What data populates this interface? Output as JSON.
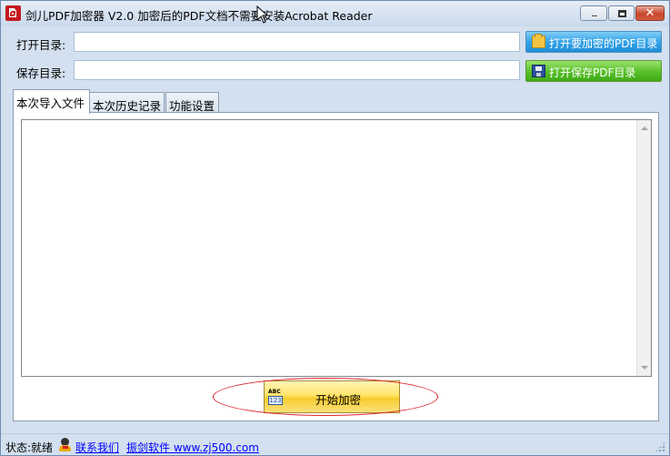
{
  "window": {
    "title": "剑儿PDF加密器  V2.0 加密后的PDF文档不需要安装Acrobat Reader",
    "controls": {
      "minimize": "minimize",
      "maximize": "maximize",
      "close": "✕"
    }
  },
  "open_dir": {
    "label": "打开目录:",
    "value": "",
    "button_label": "打开要加密的PDF目录",
    "icon": "folder-open-icon"
  },
  "save_dir": {
    "label": "保存目录:",
    "value": "",
    "button_label": "打开保存PDF目录",
    "icon": "floppy-disk-icon"
  },
  "tabs": [
    {
      "label": "本次导入文件",
      "active": true
    },
    {
      "label": "本次历史记录",
      "active": false
    },
    {
      "label": "功能设置",
      "active": false
    }
  ],
  "file_list": {
    "items": []
  },
  "start_button": {
    "label": "开始加密",
    "icon": "abc-123-icon",
    "icon_top": "ABC",
    "icon_bottom": "123"
  },
  "status_bar": {
    "status": "状态:就绪",
    "contact_label": "联系我们",
    "site_label": "振剑软件 www.zj500.com"
  },
  "colors": {
    "titlebar_bg": "#c9d9ec",
    "window_bg": "#d3e0ef",
    "open_button": "#35a3e7",
    "save_button": "#5cc22d",
    "start_button": "#ffe46a",
    "highlight_ellipse": "#d9242b",
    "link": "#0000ff"
  }
}
